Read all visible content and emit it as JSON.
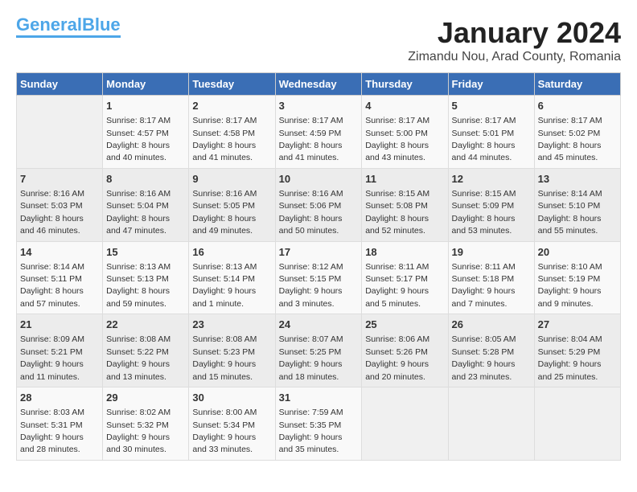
{
  "logo": {
    "part1": "General",
    "part2": "Blue"
  },
  "title": "January 2024",
  "location": "Zimandu Nou, Arad County, Romania",
  "days_of_week": [
    "Sunday",
    "Monday",
    "Tuesday",
    "Wednesday",
    "Thursday",
    "Friday",
    "Saturday"
  ],
  "weeks": [
    [
      {
        "day": "",
        "sunrise": "",
        "sunset": "",
        "daylight": ""
      },
      {
        "day": "1",
        "sunrise": "Sunrise: 8:17 AM",
        "sunset": "Sunset: 4:57 PM",
        "daylight": "Daylight: 8 hours and 40 minutes."
      },
      {
        "day": "2",
        "sunrise": "Sunrise: 8:17 AM",
        "sunset": "Sunset: 4:58 PM",
        "daylight": "Daylight: 8 hours and 41 minutes."
      },
      {
        "day": "3",
        "sunrise": "Sunrise: 8:17 AM",
        "sunset": "Sunset: 4:59 PM",
        "daylight": "Daylight: 8 hours and 41 minutes."
      },
      {
        "day": "4",
        "sunrise": "Sunrise: 8:17 AM",
        "sunset": "Sunset: 5:00 PM",
        "daylight": "Daylight: 8 hours and 43 minutes."
      },
      {
        "day": "5",
        "sunrise": "Sunrise: 8:17 AM",
        "sunset": "Sunset: 5:01 PM",
        "daylight": "Daylight: 8 hours and 44 minutes."
      },
      {
        "day": "6",
        "sunrise": "Sunrise: 8:17 AM",
        "sunset": "Sunset: 5:02 PM",
        "daylight": "Daylight: 8 hours and 45 minutes."
      }
    ],
    [
      {
        "day": "7",
        "sunrise": "Sunrise: 8:16 AM",
        "sunset": "Sunset: 5:03 PM",
        "daylight": "Daylight: 8 hours and 46 minutes."
      },
      {
        "day": "8",
        "sunrise": "Sunrise: 8:16 AM",
        "sunset": "Sunset: 5:04 PM",
        "daylight": "Daylight: 8 hours and 47 minutes."
      },
      {
        "day": "9",
        "sunrise": "Sunrise: 8:16 AM",
        "sunset": "Sunset: 5:05 PM",
        "daylight": "Daylight: 8 hours and 49 minutes."
      },
      {
        "day": "10",
        "sunrise": "Sunrise: 8:16 AM",
        "sunset": "Sunset: 5:06 PM",
        "daylight": "Daylight: 8 hours and 50 minutes."
      },
      {
        "day": "11",
        "sunrise": "Sunrise: 8:15 AM",
        "sunset": "Sunset: 5:08 PM",
        "daylight": "Daylight: 8 hours and 52 minutes."
      },
      {
        "day": "12",
        "sunrise": "Sunrise: 8:15 AM",
        "sunset": "Sunset: 5:09 PM",
        "daylight": "Daylight: 8 hours and 53 minutes."
      },
      {
        "day": "13",
        "sunrise": "Sunrise: 8:14 AM",
        "sunset": "Sunset: 5:10 PM",
        "daylight": "Daylight: 8 hours and 55 minutes."
      }
    ],
    [
      {
        "day": "14",
        "sunrise": "Sunrise: 8:14 AM",
        "sunset": "Sunset: 5:11 PM",
        "daylight": "Daylight: 8 hours and 57 minutes."
      },
      {
        "day": "15",
        "sunrise": "Sunrise: 8:13 AM",
        "sunset": "Sunset: 5:13 PM",
        "daylight": "Daylight: 8 hours and 59 minutes."
      },
      {
        "day": "16",
        "sunrise": "Sunrise: 8:13 AM",
        "sunset": "Sunset: 5:14 PM",
        "daylight": "Daylight: 9 hours and 1 minute."
      },
      {
        "day": "17",
        "sunrise": "Sunrise: 8:12 AM",
        "sunset": "Sunset: 5:15 PM",
        "daylight": "Daylight: 9 hours and 3 minutes."
      },
      {
        "day": "18",
        "sunrise": "Sunrise: 8:11 AM",
        "sunset": "Sunset: 5:17 PM",
        "daylight": "Daylight: 9 hours and 5 minutes."
      },
      {
        "day": "19",
        "sunrise": "Sunrise: 8:11 AM",
        "sunset": "Sunset: 5:18 PM",
        "daylight": "Daylight: 9 hours and 7 minutes."
      },
      {
        "day": "20",
        "sunrise": "Sunrise: 8:10 AM",
        "sunset": "Sunset: 5:19 PM",
        "daylight": "Daylight: 9 hours and 9 minutes."
      }
    ],
    [
      {
        "day": "21",
        "sunrise": "Sunrise: 8:09 AM",
        "sunset": "Sunset: 5:21 PM",
        "daylight": "Daylight: 9 hours and 11 minutes."
      },
      {
        "day": "22",
        "sunrise": "Sunrise: 8:08 AM",
        "sunset": "Sunset: 5:22 PM",
        "daylight": "Daylight: 9 hours and 13 minutes."
      },
      {
        "day": "23",
        "sunrise": "Sunrise: 8:08 AM",
        "sunset": "Sunset: 5:23 PM",
        "daylight": "Daylight: 9 hours and 15 minutes."
      },
      {
        "day": "24",
        "sunrise": "Sunrise: 8:07 AM",
        "sunset": "Sunset: 5:25 PM",
        "daylight": "Daylight: 9 hours and 18 minutes."
      },
      {
        "day": "25",
        "sunrise": "Sunrise: 8:06 AM",
        "sunset": "Sunset: 5:26 PM",
        "daylight": "Daylight: 9 hours and 20 minutes."
      },
      {
        "day": "26",
        "sunrise": "Sunrise: 8:05 AM",
        "sunset": "Sunset: 5:28 PM",
        "daylight": "Daylight: 9 hours and 23 minutes."
      },
      {
        "day": "27",
        "sunrise": "Sunrise: 8:04 AM",
        "sunset": "Sunset: 5:29 PM",
        "daylight": "Daylight: 9 hours and 25 minutes."
      }
    ],
    [
      {
        "day": "28",
        "sunrise": "Sunrise: 8:03 AM",
        "sunset": "Sunset: 5:31 PM",
        "daylight": "Daylight: 9 hours and 28 minutes."
      },
      {
        "day": "29",
        "sunrise": "Sunrise: 8:02 AM",
        "sunset": "Sunset: 5:32 PM",
        "daylight": "Daylight: 9 hours and 30 minutes."
      },
      {
        "day": "30",
        "sunrise": "Sunrise: 8:00 AM",
        "sunset": "Sunset: 5:34 PM",
        "daylight": "Daylight: 9 hours and 33 minutes."
      },
      {
        "day": "31",
        "sunrise": "Sunrise: 7:59 AM",
        "sunset": "Sunset: 5:35 PM",
        "daylight": "Daylight: 9 hours and 35 minutes."
      },
      {
        "day": "",
        "sunrise": "",
        "sunset": "",
        "daylight": ""
      },
      {
        "day": "",
        "sunrise": "",
        "sunset": "",
        "daylight": ""
      },
      {
        "day": "",
        "sunrise": "",
        "sunset": "",
        "daylight": ""
      }
    ]
  ]
}
